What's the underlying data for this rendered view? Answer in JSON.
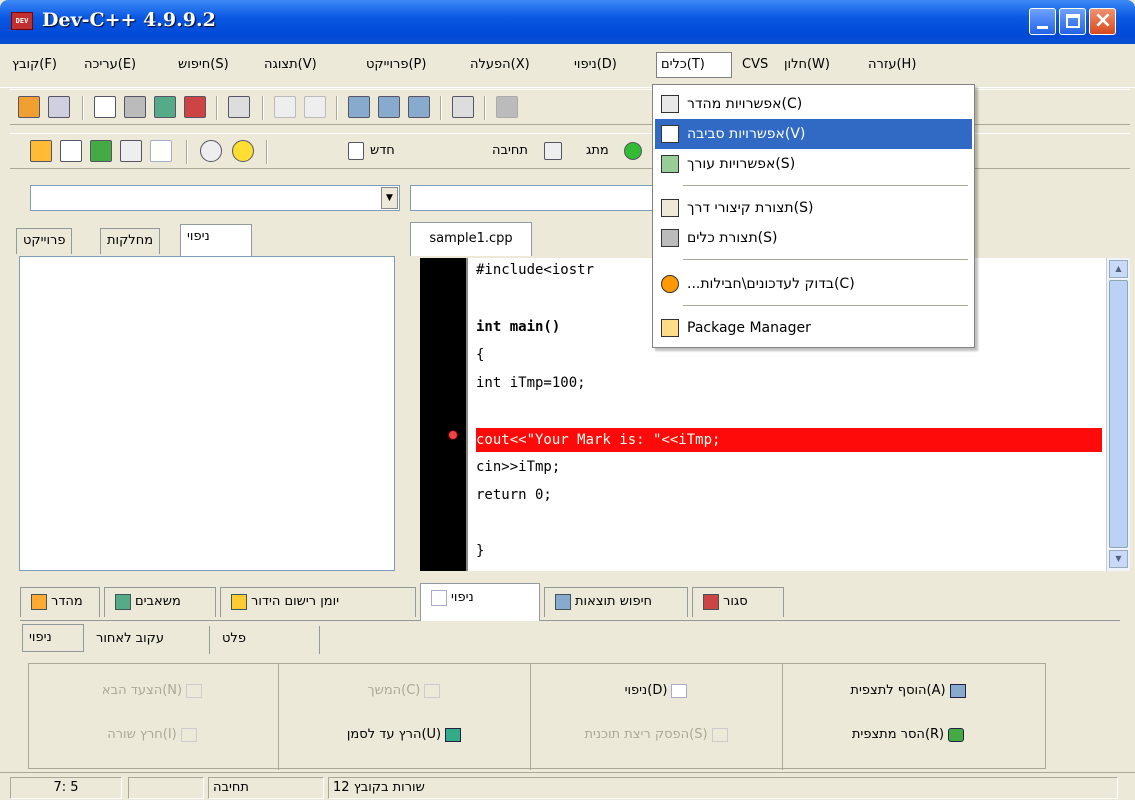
{
  "window": {
    "title": "Dev-C++ 4.9.9.2",
    "icon_label": "DEV"
  },
  "menubar": [
    "קובץ(F)",
    "עריכה(E)",
    "חיפוש(S)",
    "תצוגה(V)",
    "פרוייקט(P)",
    "הפעלה(X)",
    "ניפוי(D)",
    "כלים(T)",
    "CVS",
    "חלון(W)",
    "עזרה(H)"
  ],
  "toolbar2": {
    "new_label": "חדש",
    "compile_label": "תחיבה",
    "run_label": "מתג"
  },
  "left_tabs": [
    "פרוייקט",
    "מחלקות",
    "ניפוי"
  ],
  "editor": {
    "tab": "sample1.cpp",
    "lines": [
      "#include<iostr",
      "",
      "int main()",
      "{",
      "int iTmp=100;",
      "",
      "cout<<\"Your Mark is: \"<<iTmp;",
      "cin>>iTmp;",
      "return 0;",
      "",
      "}"
    ]
  },
  "bottom_tabs": [
    "מהדר",
    "משאבים",
    "יומן רישום הידור",
    "ניפוי",
    "חיפוש תוצאות",
    "סגור"
  ],
  "sub_tabs": [
    "ניפוי",
    "עקוב לאחור",
    "פלט"
  ],
  "debug_buttons": {
    "next_step": "הצעד הבא(N)",
    "step_into": "חרץ שורה(I)",
    "continue": "המשך(C)",
    "run_to_cursor": "הרץ עד לסמן(U)",
    "debug": "ניפוי(D)",
    "stop": "הפסק ריצת תוכנית(S)",
    "add_watch": "הוסף לתצפית(A)",
    "remove_watch": "הסר מתצפית(R)"
  },
  "statusbar": {
    "position": "7: 5",
    "mode": "תחיבה",
    "info": "12 שורות בקובץ"
  },
  "tools_menu": [
    {
      "label": "אפשרויות מהדר(C)",
      "icon": "compiler-options-icon"
    },
    {
      "label": "אפשרויות סביבה(V)",
      "icon": "environment-options-icon",
      "selected": true
    },
    {
      "label": "אפשרויות עורך(S)",
      "icon": "editor-options-icon"
    },
    {
      "label": "תצורת קיצורי דרך(S)",
      "icon": "shortcuts-icon"
    },
    {
      "label": "תצורת כלים(S)",
      "icon": "tools-config-icon"
    },
    {
      "label": "...בדוק לעדכונים\\חבילות(C)",
      "icon": "update-icon"
    },
    {
      "label": "Package Manager",
      "icon": "package-manager-icon"
    }
  ],
  "colors": {
    "titlebar": "#0a58e2",
    "highlight_line": "#fe0a0a",
    "menu_selected": "#316ac5",
    "keyword": "#000000",
    "number": "#8000ff"
  }
}
